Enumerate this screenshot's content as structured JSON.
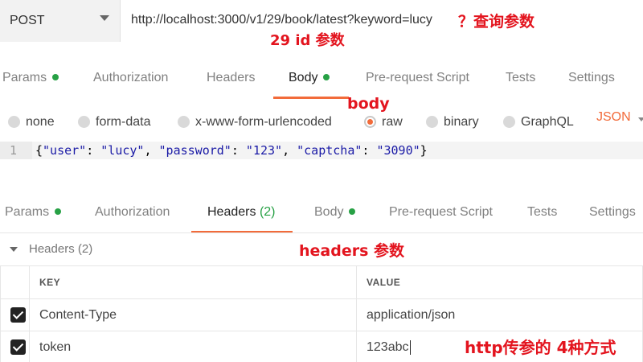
{
  "request": {
    "method": "POST",
    "url": "http://localhost:3000/v1/29/book/latest?keyword=lucy"
  },
  "notes": {
    "query": "？查询参数",
    "path": "29 id 参数",
    "body": "body",
    "headers": "headers 参数",
    "summary": "http传参的 4种方式"
  },
  "top_tabs": [
    {
      "label": "Params",
      "dot": true
    },
    {
      "label": "Authorization"
    },
    {
      "label": "Headers"
    },
    {
      "label": "Body",
      "dot": true,
      "active": true
    },
    {
      "label": "Pre-request Script"
    },
    {
      "label": "Tests"
    },
    {
      "label": "Settings"
    }
  ],
  "body_types": [
    "none",
    "form-data",
    "x-www-form-urlencoded",
    "raw",
    "binary",
    "GraphQL"
  ],
  "body_selected": "raw",
  "body_format": "JSON",
  "editor": {
    "line_number": "1",
    "code": "{\"user\": \"lucy\", \"password\": \"123\", \"captcha\": \"3090\"}"
  },
  "bottom_tabs": [
    {
      "label": "Params",
      "dot": true
    },
    {
      "label": "Authorization"
    },
    {
      "label": "Headers",
      "count": "(2)",
      "active": true
    },
    {
      "label": "Body",
      "dot": true
    },
    {
      "label": "Pre-request Script"
    },
    {
      "label": "Tests"
    },
    {
      "label": "Settings"
    }
  ],
  "headers_section": {
    "title": "Headers",
    "count": "(2)",
    "columns": [
      "KEY",
      "VALUE"
    ],
    "rows": [
      {
        "checked": true,
        "key": "Content-Type",
        "value": "application/json"
      },
      {
        "checked": true,
        "key": "token",
        "value": "123abc"
      }
    ]
  },
  "colors": {
    "accent": "#f26b3a",
    "annotation": "#e3141e",
    "dot_green": "#27a145"
  }
}
